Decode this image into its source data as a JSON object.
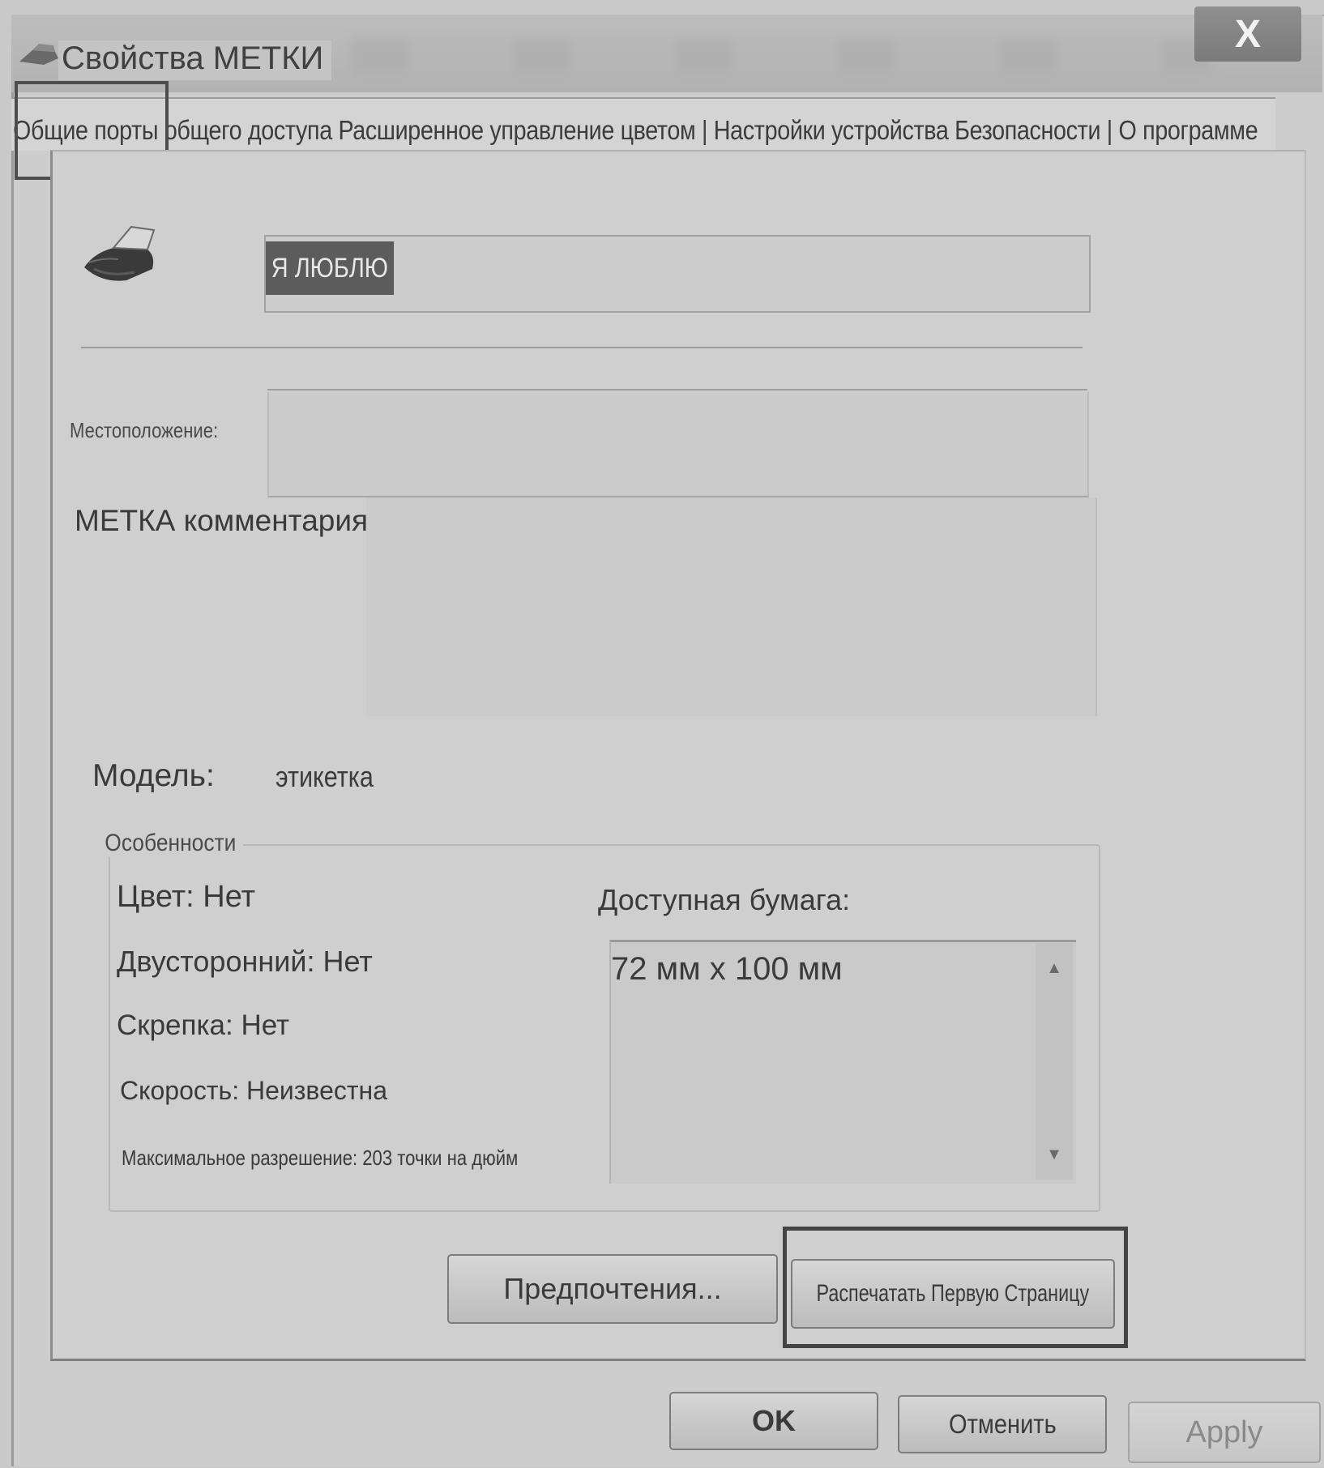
{
  "window": {
    "title": "Свойства МЕТКИ",
    "close_glyph": "X"
  },
  "tabs_line": "Общие порты общего доступа Расширенное управление цветом | Настройки устройства Безопасности | О программе",
  "general": {
    "printer_name": "Я ЛЮБЛЮ",
    "location_label": "Местоположение:",
    "comment_label": "МЕТКА комментария",
    "model_label": "Модель:",
    "model_value": "этикетка"
  },
  "features": {
    "title": "Особенности",
    "color": "Цвет: Нет",
    "duplex": "Двусторонний: Нет",
    "staple": "Скрепка: Нет",
    "speed": "Скорость: Неизвестна",
    "max_resolution": "Максимальное разрешение: 203 точки на дюйм",
    "paper_label": "Доступная бумага:",
    "paper_items": [
      "72 мм х 100 мм"
    ]
  },
  "buttons": {
    "preferences": "Предпочтения...",
    "print_test_page": "Распечатать Первую Страницу",
    "ok": "OK",
    "cancel": "Отменить",
    "apply": "Apply"
  },
  "icons": {
    "title": "printer-icon",
    "main": "printer-icon",
    "scroll_up": "arrow-up-icon",
    "scroll_down": "arrow-down-icon"
  }
}
